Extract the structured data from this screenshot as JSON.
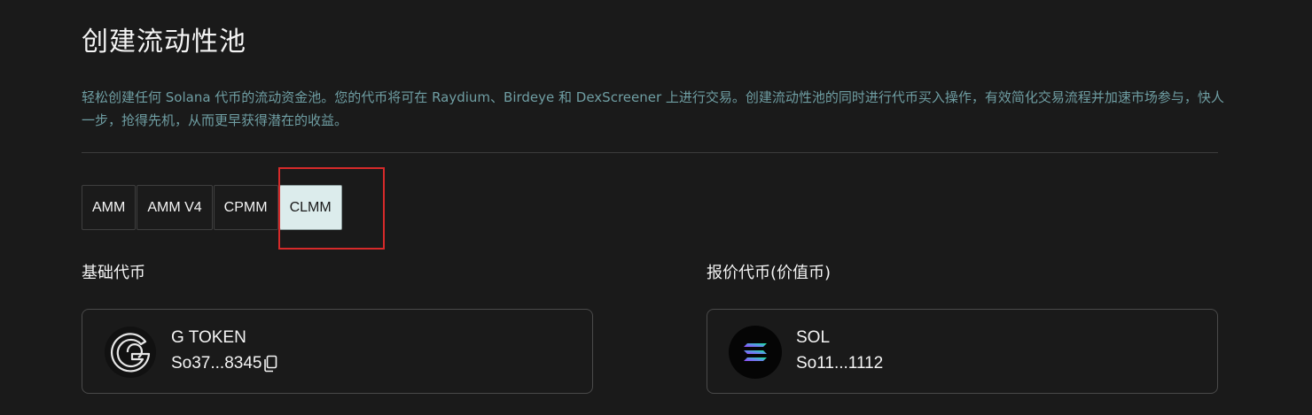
{
  "page": {
    "title": "创建流动性池",
    "description": "轻松创建任何 Solana 代币的流动资金池。您的代币将可在 Raydium、Birdeye 和 DexScreener 上进行交易。创建流动性池的同时进行代币买入操作，有效简化交易流程并加速市场参与，快人一步，抢得先机，从而更早获得潜在的收益。"
  },
  "pool_types": {
    "tabs": [
      {
        "label": "AMM",
        "active": false
      },
      {
        "label": "AMM V4",
        "active": false
      },
      {
        "label": "CPMM",
        "active": false
      },
      {
        "label": "CLMM",
        "active": true
      }
    ]
  },
  "base_token": {
    "section_label": "基础代币",
    "name": "G TOKEN",
    "address": "So37...8345",
    "icon": "g-token-logo-icon"
  },
  "quote_token": {
    "section_label": "报价代币(价值币)",
    "name": "SOL",
    "address": "So11...1112",
    "icon": "solana-logo-icon"
  },
  "colors": {
    "background": "#1a1a1a",
    "description_text": "#6f9ea3",
    "active_tab_bg": "#dcecec",
    "highlight_border": "#d62a2a",
    "card_border": "#4a4a4a"
  }
}
